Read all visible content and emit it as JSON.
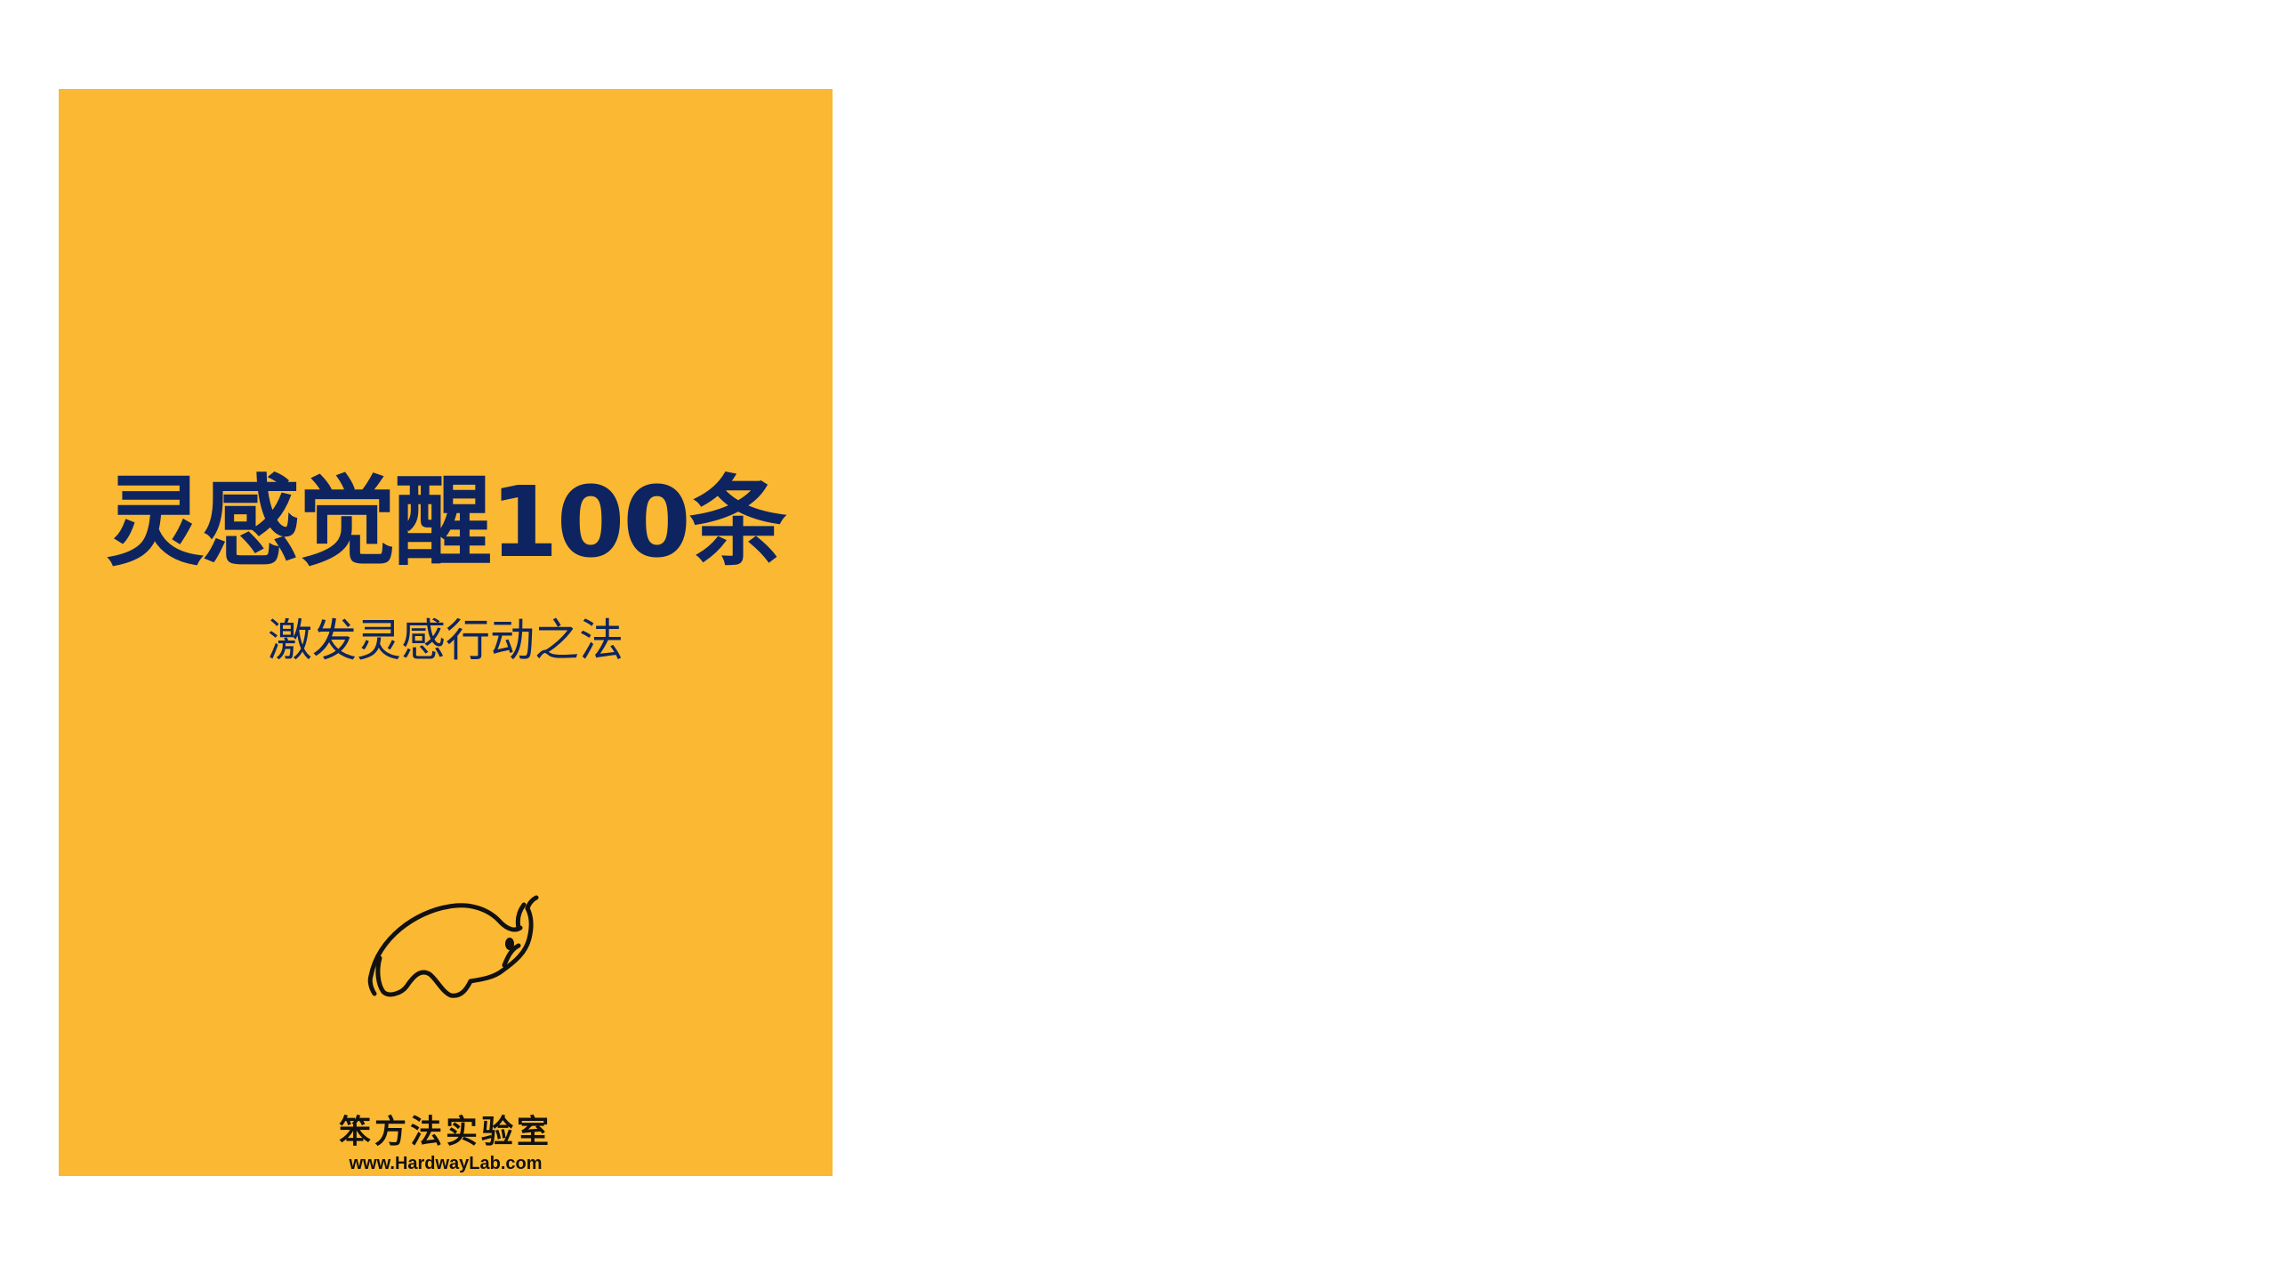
{
  "cover": {
    "background_color": "#fbb832",
    "text_color": "#0d2460",
    "title": "灵感觉醒100条",
    "subtitle": "激发灵感行动之法",
    "logo_icon": "bull-icon",
    "brand_name": "笨方法实验室",
    "website": "www.HardwayLab.com"
  }
}
